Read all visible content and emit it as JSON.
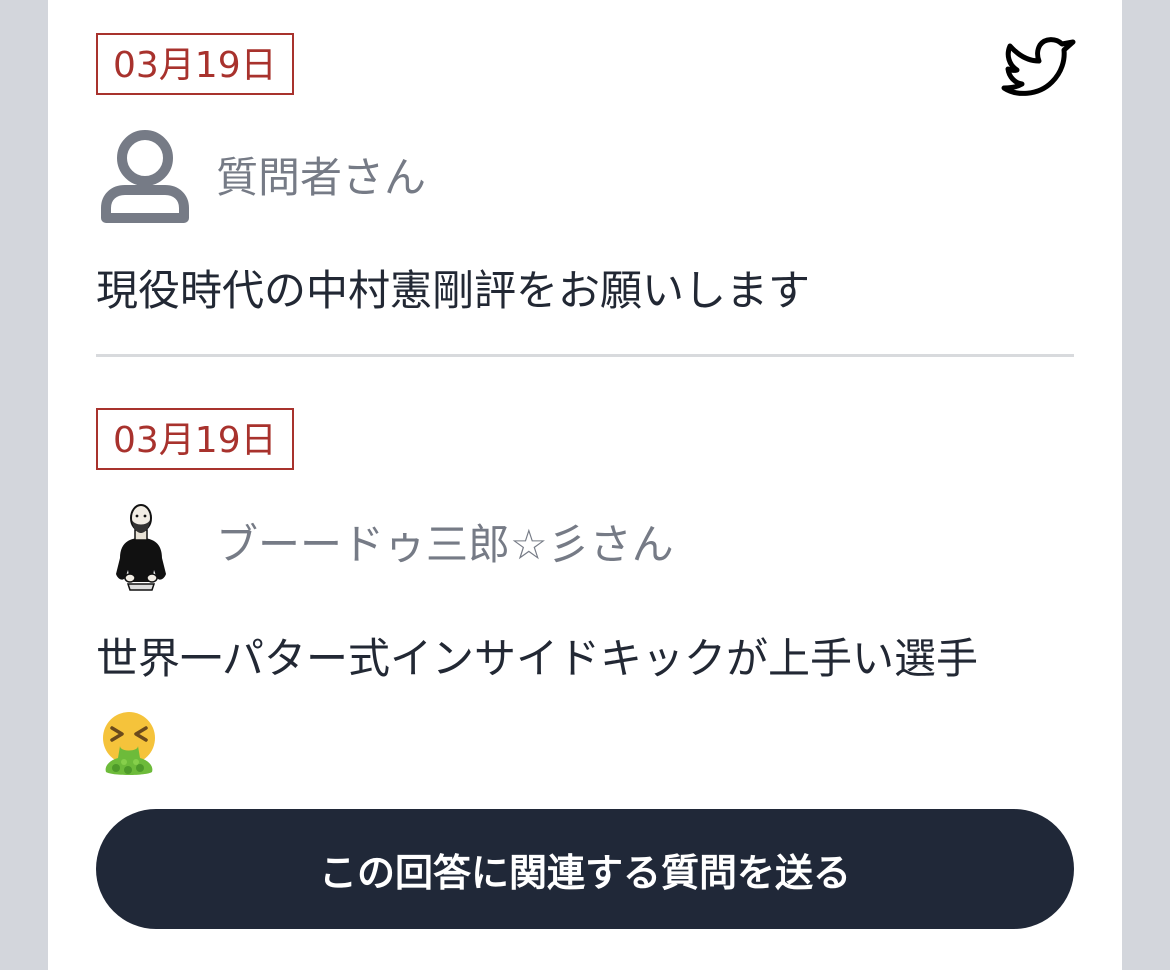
{
  "question": {
    "date": "03月19日",
    "author": "質問者さん",
    "text": "現役時代の中村憲剛評をお願いします",
    "icons": {
      "share": "twitter-bird-icon",
      "avatar": "person-outline-icon"
    }
  },
  "answer": {
    "date": "03月19日",
    "author": "ブーードゥ三郎☆彡さん",
    "text": "世界一パター式インサイドキックが上手い選手",
    "emoji": "🤮",
    "icons": {
      "avatar": "bald-man-illustration-avatar",
      "emoji": "vomiting-face-icon"
    }
  },
  "cta": {
    "label": "この回答に関連する質問を送る"
  },
  "colors": {
    "accent_red": "#a8322d",
    "button_bg": "#202838",
    "muted_text": "#767b86",
    "body_text": "#222834",
    "background": "#d3d6dc"
  }
}
